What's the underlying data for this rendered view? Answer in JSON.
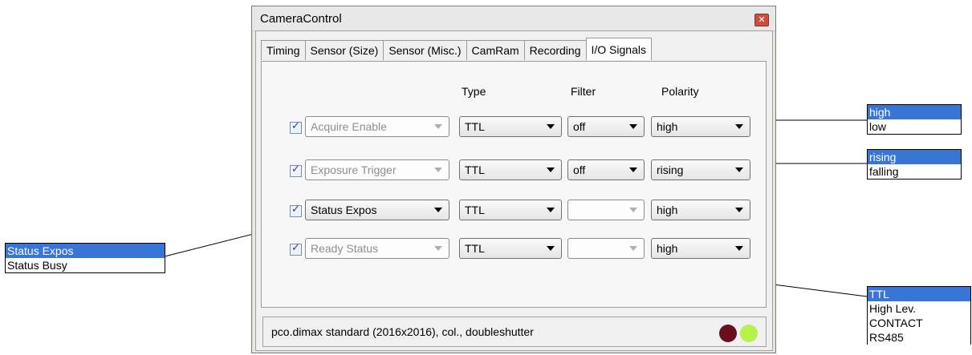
{
  "window": {
    "title": "CameraControl"
  },
  "tabs": [
    {
      "label": "Timing"
    },
    {
      "label": "Sensor (Size)"
    },
    {
      "label": "Sensor (Misc.)"
    },
    {
      "label": "CamRam"
    },
    {
      "label": "Recording"
    },
    {
      "label": "I/O Signals",
      "active": true
    }
  ],
  "columns": {
    "type": "Type",
    "filter": "Filter",
    "polarity": "Polarity"
  },
  "signals": [
    {
      "name": "Acquire Enable",
      "checked": true,
      "name_enabled": false,
      "type": "TTL",
      "filter": "off",
      "polarity": "high"
    },
    {
      "name": "Exposure Trigger",
      "checked": true,
      "name_enabled": false,
      "type": "TTL",
      "filter": "off",
      "polarity": "rising"
    },
    {
      "name": "Status Expos",
      "checked": true,
      "name_enabled": true,
      "type": "TTL",
      "filter": "",
      "polarity": "high"
    },
    {
      "name": "Ready Status",
      "checked": true,
      "name_enabled": false,
      "type": "TTL",
      "filter": "",
      "polarity": "high"
    }
  ],
  "status": {
    "text": "pco.dimax standard (2016x2016), col., doubleshutter",
    "led1_color": "#6b0f1f",
    "led2_color": "#b8f04a"
  },
  "callouts": {
    "polarity_high_low": [
      "high",
      "low"
    ],
    "polarity_edge": [
      "rising",
      "falling"
    ],
    "status_signal": [
      "Status Expos",
      "Status Busy"
    ],
    "type": [
      "TTL",
      "High Lev.",
      "CONTACT",
      "RS485"
    ]
  },
  "colors": {
    "selection": "#3875d7"
  }
}
